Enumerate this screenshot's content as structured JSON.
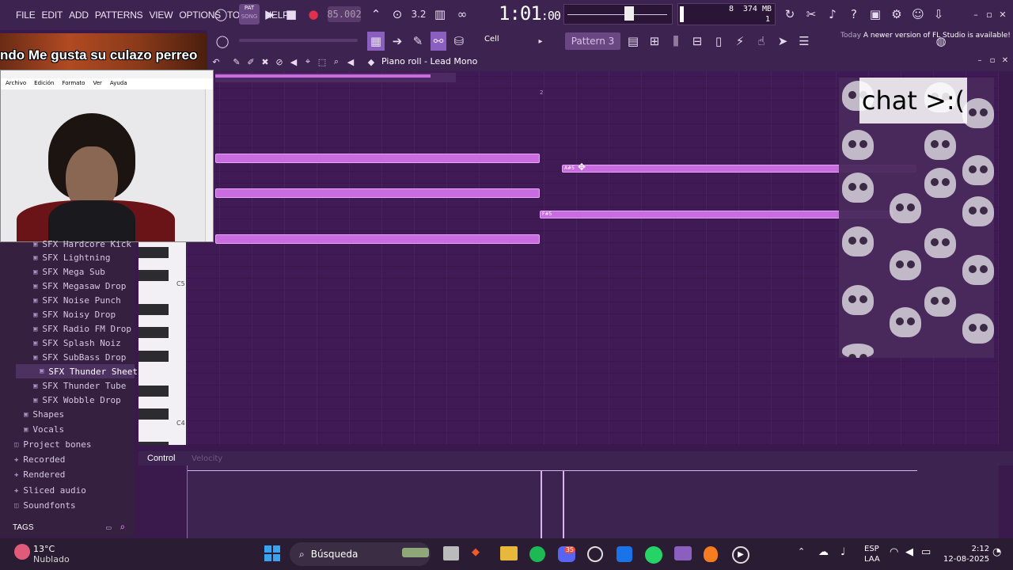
{
  "menu": [
    "FILE",
    "EDIT",
    "ADD",
    "PATTERNS",
    "VIEW",
    "OPTIONS",
    "TOOLS",
    "HELP"
  ],
  "transport": {
    "mode_top": "PAT",
    "mode_bottom": "SONG",
    "bpm": "85.002",
    "time": "1:01",
    "time_small": ":00",
    "step": "3.2"
  },
  "monitor": {
    "cpu": "8",
    "memory": "374 MB",
    "polyphony": "1"
  },
  "toolbar2": {
    "snap": "Cell",
    "pattern": "Pattern 3",
    "news_when": "Today",
    "news_text": "A newer version of FL Studio is available!"
  },
  "overlay": {
    "text": "ndo  Me gusta su culazo perreo"
  },
  "webcam": {
    "menu": [
      "Archivo",
      "Edición",
      "Formato",
      "Ver",
      "Ayuda"
    ]
  },
  "piano_roll": {
    "title": "Piano roll - Lead Mono",
    "bar_marker": "2",
    "key_c5": "C5",
    "key_c4": "C4",
    "note_a": "A#5",
    "note_f": "F#5"
  },
  "sticker": {
    "text": "chat >:("
  },
  "browser": {
    "items": [
      {
        "label": "SFX Hardcore Kick",
        "kind": "folder"
      },
      {
        "label": "SFX Lightning",
        "kind": "folder"
      },
      {
        "label": "SFX Mega Sub",
        "kind": "folder"
      },
      {
        "label": "SFX Megasaw Drop",
        "kind": "folder"
      },
      {
        "label": "SFX Noise Punch",
        "kind": "folder"
      },
      {
        "label": "SFX Noisy Drop",
        "kind": "folder"
      },
      {
        "label": "SFX Radio FM Drop",
        "kind": "folder"
      },
      {
        "label": "SFX Splash Noiz",
        "kind": "folder"
      },
      {
        "label": "SFX SubBass Drop",
        "kind": "folder"
      },
      {
        "label": "SFX Thunder Sheet",
        "kind": "folder-selected"
      },
      {
        "label": "SFX Thunder Tube",
        "kind": "folder"
      },
      {
        "label": "SFX Wobble Drop",
        "kind": "folder"
      },
      {
        "label": "Shapes",
        "kind": "folder"
      },
      {
        "label": "Vocals",
        "kind": "folder"
      },
      {
        "label": "Project bones",
        "kind": "special"
      },
      {
        "label": "Recorded",
        "kind": "special"
      },
      {
        "label": "Rendered",
        "kind": "special"
      },
      {
        "label": "Sliced audio",
        "kind": "special"
      },
      {
        "label": "Soundfonts",
        "kind": "special"
      }
    ],
    "tags": "TAGS"
  },
  "control_lane": {
    "label": "Control",
    "sub": "Velocity"
  },
  "taskbar": {
    "weather_temp": "13°C",
    "weather_desc": "Nublado",
    "search": "Búsqueda",
    "lang1": "ESP",
    "lang2": "LAA",
    "time": "2:12",
    "date": "12-08-2025",
    "discord_badge": "35"
  },
  "colors": {
    "accent": "#c86ce0",
    "background": "#3f1a55",
    "toolbar": "#3d2350"
  }
}
